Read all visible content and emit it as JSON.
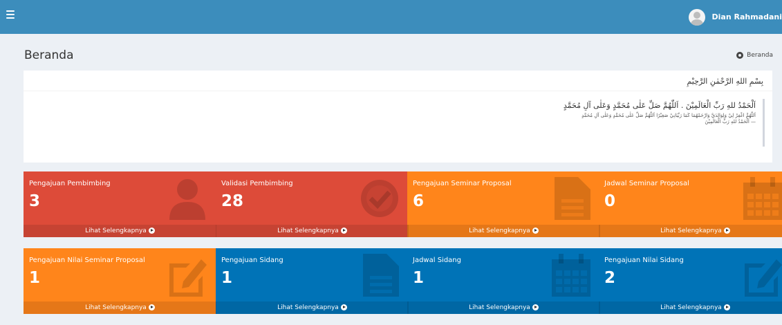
{
  "header": {
    "username": "Dian Rahmadani"
  },
  "page": {
    "title": "Beranda",
    "breadcrumb": "Beranda"
  },
  "card": {
    "heading": "بِسْمِ اللهِ الرَّحْمٰنِ الرَّحِيْمِ",
    "quote_line1": "اَلْحَمْدُ للهِ رَبِّ الْعَالَمِيْنَ . اَللّٰهُمَّ صَلِّ عَلٰى مُحَمَّدٍ وَعَلٰى آلِ مُحَمَّدٍ",
    "quote_line2": "اَللّٰهُمَّ اغْفِرْ لِيْ وَلِوَالِدَيَّ وَارْحَمْهُمَا كَمَا رَبَّيَانِيْ صَغِيْرًا اَللّٰهُمَّ صَلِّ عَلٰى مُحَمَّدٍ وَعَلٰى آلِ مُحَمَّدٍ",
    "quote_line3": "— اَلْحَمْدُ للهِ رَبِّ الْعَالَمِيْنَ"
  },
  "boxes": [
    {
      "title": "Pengajuan Pembimbing",
      "count": "3",
      "footer": "Lihat Selengkapnya",
      "color": "#dd4b39",
      "icon": "user-icon"
    },
    {
      "title": "Validasi Pembimbing",
      "count": "28",
      "footer": "Lihat Selengkapnya",
      "color": "#dd4b39",
      "icon": "check-circle-icon"
    },
    {
      "title": "Pengajuan Seminar Proposal",
      "count": "6",
      "footer": "Lihat Selengkapnya",
      "color": "#ff851b",
      "icon": "file-icon"
    },
    {
      "title": "Jadwal Seminar Proposal",
      "count": "0",
      "footer": "Lihat Selengkapnya",
      "color": "#ff851b",
      "icon": "calendar-icon"
    },
    {
      "title": "Pengajuan Nilai Seminar Proposal",
      "count": "1",
      "footer": "Lihat Selengkapnya",
      "color": "#ff851b",
      "icon": "edit-icon"
    },
    {
      "title": "Pengajuan Sidang",
      "count": "1",
      "footer": "Lihat Selengkapnya",
      "color": "#0073b7",
      "icon": "file-icon"
    },
    {
      "title": "Jadwal Sidang",
      "count": "1",
      "footer": "Lihat Selengkapnya",
      "color": "#0073b7",
      "icon": "calendar-icon"
    },
    {
      "title": "Pengajuan Nilai Sidang",
      "count": "2",
      "footer": "Lihat Selengkapnya",
      "color": "#0073b7",
      "icon": "edit-icon"
    }
  ]
}
